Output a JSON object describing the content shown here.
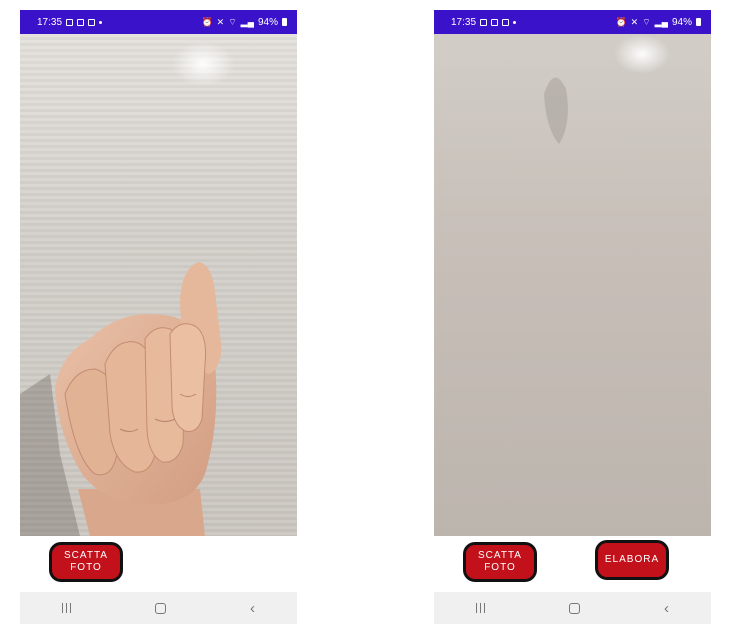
{
  "screens": [
    {
      "status": {
        "time": "17:35",
        "battery": "94%"
      },
      "buttons": [
        {
          "label": "SCATTA\nFOTO"
        }
      ]
    },
    {
      "status": {
        "time": "17:35",
        "battery": "94%"
      },
      "buttons": [
        {
          "label": "SCATTA\nFOTO"
        },
        {
          "label": "ELABORA"
        }
      ]
    }
  ],
  "icons": {
    "status_left": [
      "gallery-icon",
      "car-icon",
      "calendar-icon",
      "dot-icon"
    ],
    "status_right": [
      "alarm-icon",
      "mute-icon",
      "wifi-icon",
      "signal-icon",
      "battery-icon"
    ],
    "nav": [
      "recent-apps-icon",
      "home-icon",
      "back-icon"
    ]
  },
  "colors": {
    "status_bar": "#3a12c9",
    "button": "#c2111a",
    "button_border": "#111111",
    "nav_bar": "#f0f0f0"
  }
}
